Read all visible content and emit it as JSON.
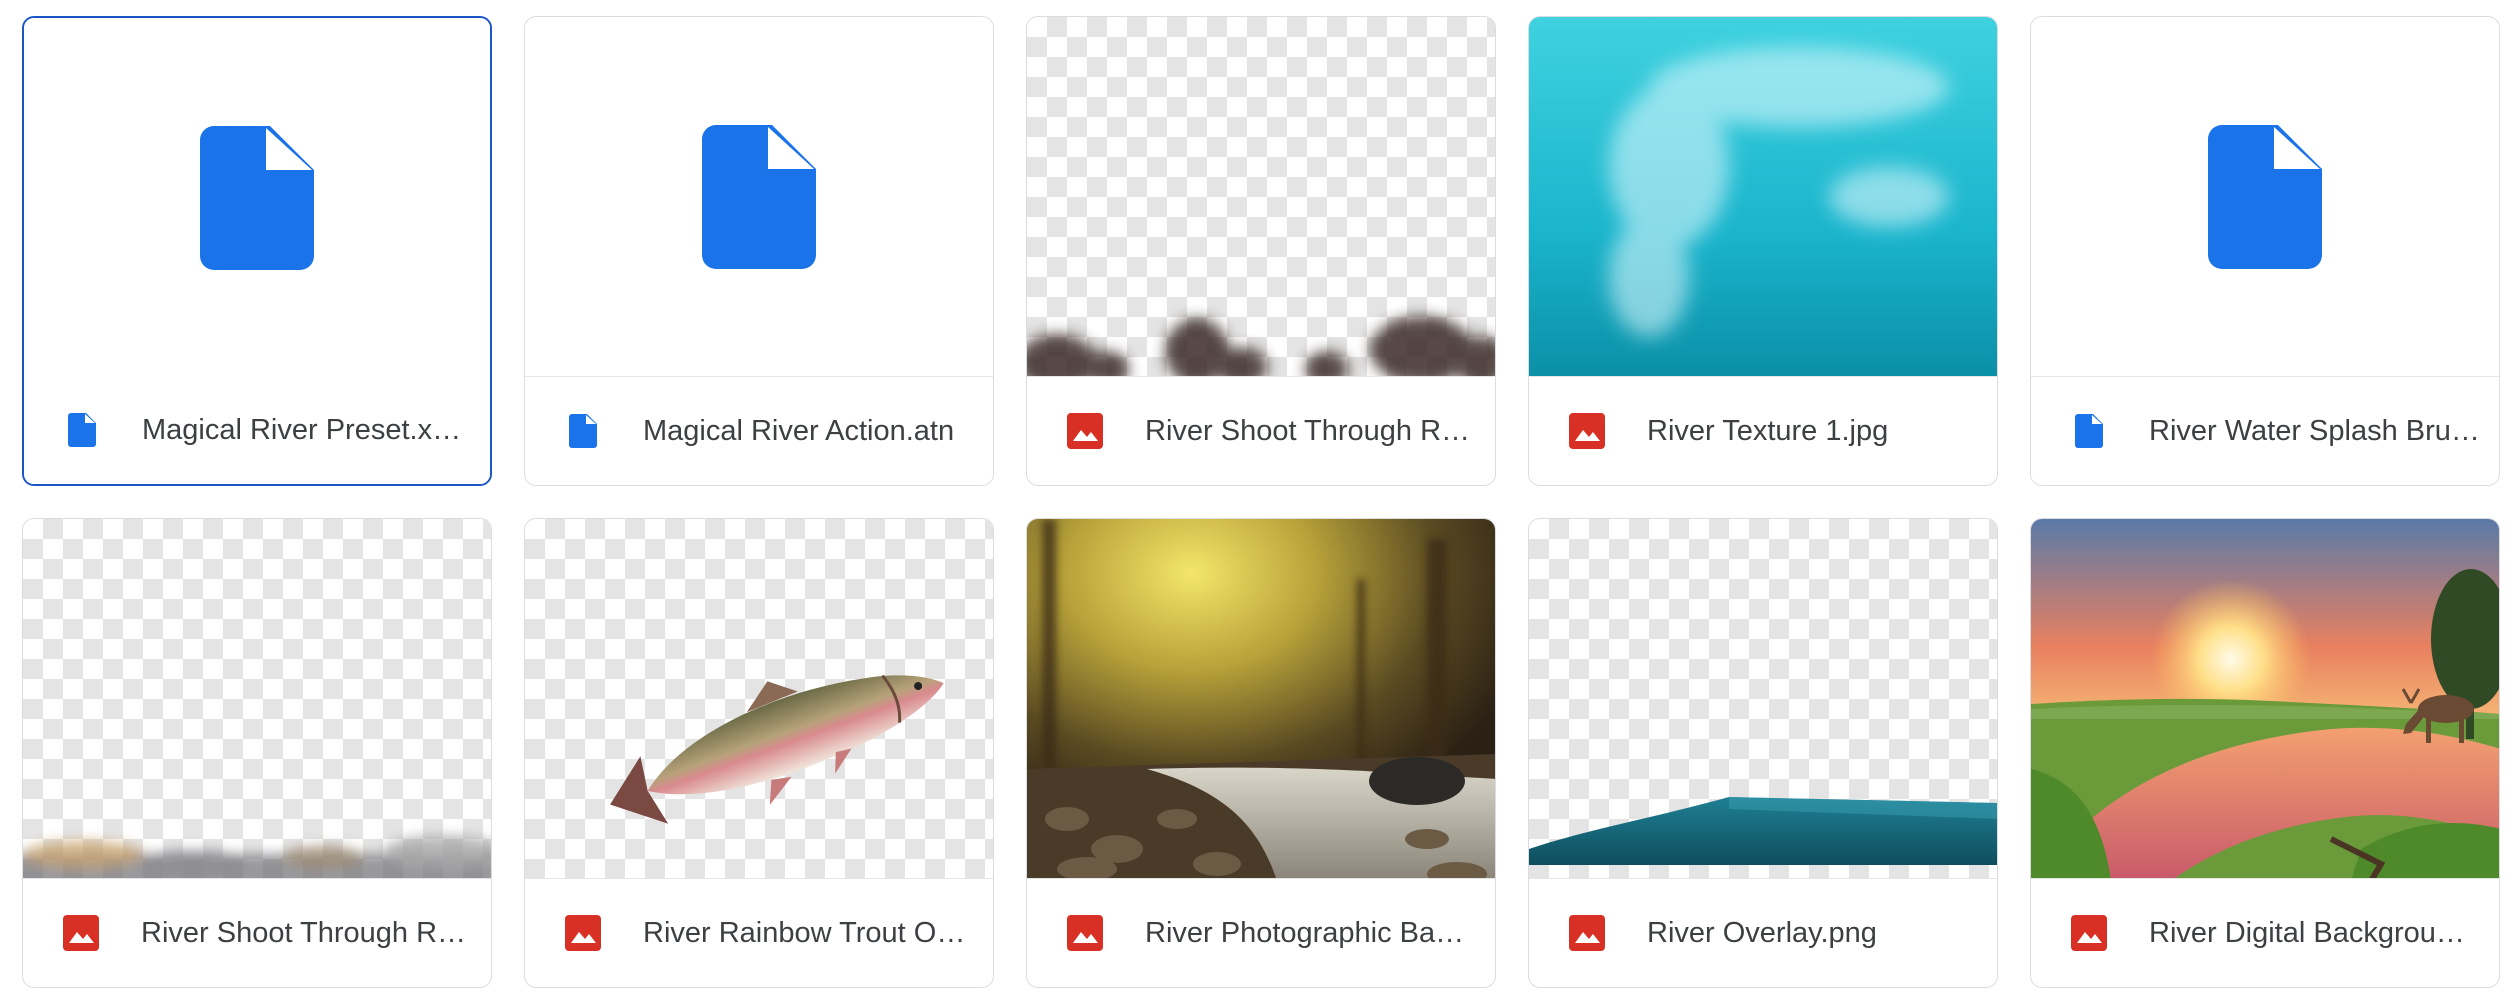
{
  "colors": {
    "doc_blue": "#1a73e8",
    "image_red": "#d93025",
    "selection_border": "#1a56c8"
  },
  "files": [
    {
      "name": "Magical River Preset.xmp",
      "display": "Magical River Preset.x…",
      "type_icon": "document-icon",
      "preview": "document-icon",
      "selected": true
    },
    {
      "name": "Magical River Action.atn",
      "display": "Magical River Action.atn",
      "type_icon": "document-icon",
      "preview": "document-icon",
      "selected": false
    },
    {
      "name": "River Shoot Through R…",
      "display": "River Shoot Through R…",
      "type_icon": "image-icon",
      "preview": "transparent-foliage-silhouette",
      "selected": false
    },
    {
      "name": "River Texture 1.jpg",
      "display": "River Texture 1.jpg",
      "type_icon": "image-icon",
      "preview": "turquoise-water-texture",
      "selected": false
    },
    {
      "name": "River Water Splash Bru…",
      "display": "River Water Splash Bru…",
      "type_icon": "document-icon",
      "preview": "document-icon",
      "selected": false
    },
    {
      "name": "River Shoot Through R…",
      "display": "River Shoot Through R…",
      "type_icon": "image-icon",
      "preview": "transparent-blurred-rocks",
      "selected": false
    },
    {
      "name": "River Rainbow Trout O…",
      "display": "River Rainbow Trout O…",
      "type_icon": "image-icon",
      "preview": "rainbow-trout-fish",
      "selected": false
    },
    {
      "name": "River Photographic Ba…",
      "display": "River Photographic Ba…",
      "type_icon": "image-icon",
      "preview": "forest-stream-photo",
      "selected": false
    },
    {
      "name": "River Overlay.png",
      "display": "River Overlay.png",
      "type_icon": "image-icon",
      "preview": "transparent-water-overlay",
      "selected": false
    },
    {
      "name": "River Digital Backgrou…",
      "display": "River Digital Backgrou…",
      "type_icon": "image-icon",
      "preview": "sunset-river-deer",
      "selected": false
    }
  ]
}
